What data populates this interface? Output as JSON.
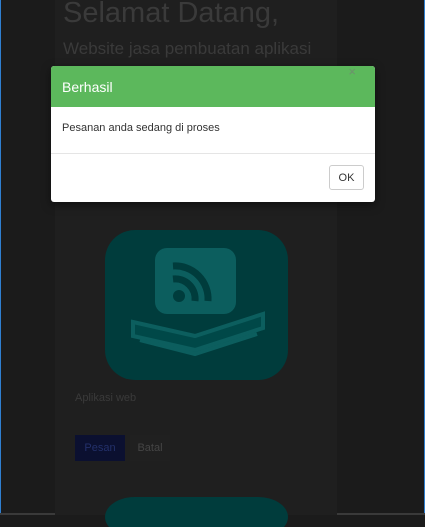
{
  "page": {
    "title": "Selamat Datang,",
    "subtitle": "Website jasa pembuatan aplikasi"
  },
  "product": {
    "icon": "rss-feed-icon",
    "name": "Aplikasi web",
    "order_label": "Pesan",
    "cancel_label": "Batal"
  },
  "modal": {
    "title": "Berhasil",
    "close_symbol": "×",
    "message": "Pesanan anda sedang di proses",
    "ok_label": "OK"
  },
  "colors": {
    "modal_header": "#5cb85c",
    "icon_tile": "#004d4d",
    "overlay": "#1b1b1b"
  }
}
